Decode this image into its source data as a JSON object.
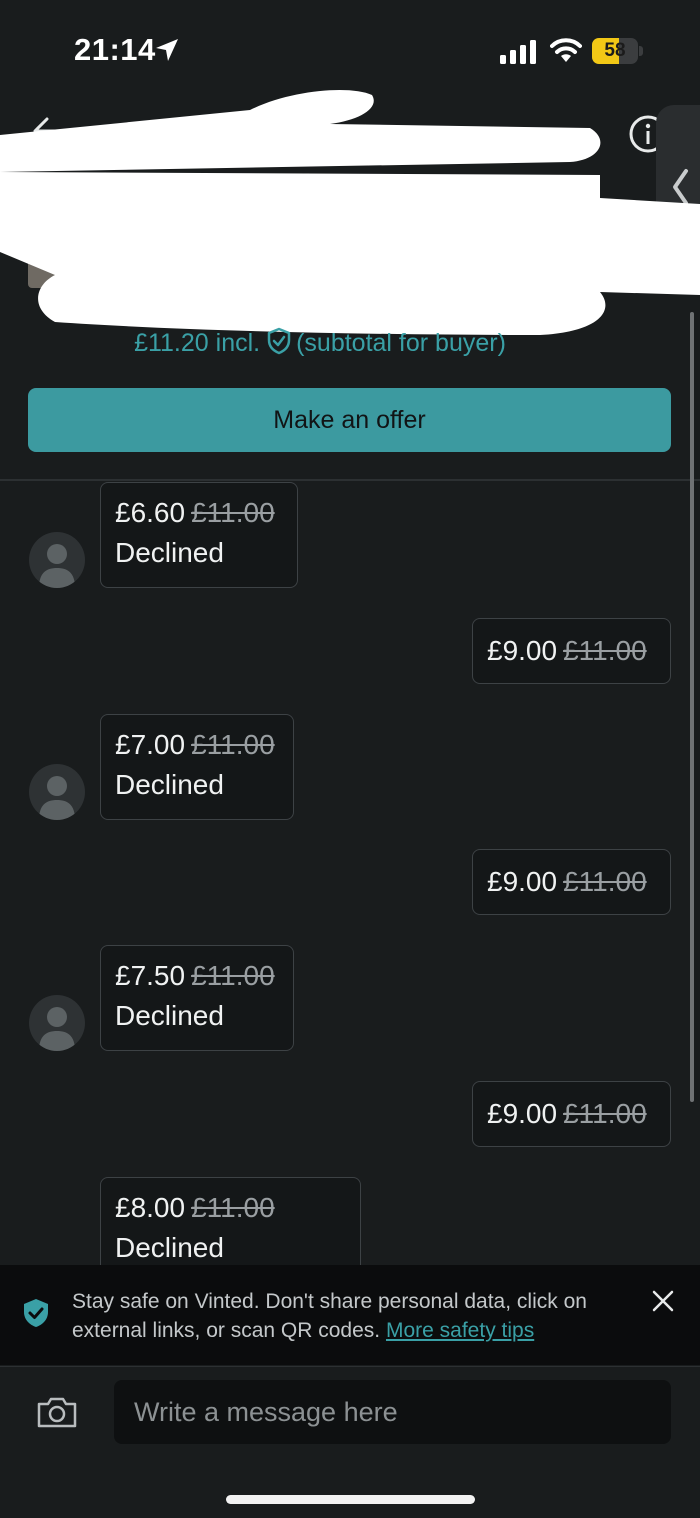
{
  "status_bar": {
    "time": "21:14",
    "battery_percent": "58",
    "battery_level": 0.58,
    "icons": [
      "location-arrow-icon",
      "signal-icon",
      "wifi-icon",
      "battery-icon"
    ]
  },
  "header": {
    "back_icon": "arrow-left-icon",
    "info_icon": "info-icon",
    "side_panel_icon": "chevron-left-icon"
  },
  "listing": {
    "price_incl": "£11.20 incl.",
    "price_note": "(subtotal for buyer)",
    "buyer_protection_icon": "shield-check-icon"
  },
  "offer_button": {
    "label": "Make an offer"
  },
  "messages": [
    {
      "direction": "incoming",
      "price": "£6.60",
      "original": "£11.00",
      "status": "Declined"
    },
    {
      "direction": "outgoing",
      "price": "£9.00",
      "original": "£11.00"
    },
    {
      "direction": "incoming",
      "price": "£7.00",
      "original": "£11.00",
      "status": "Declined"
    },
    {
      "direction": "outgoing",
      "price": "£9.00",
      "original": "£11.00"
    },
    {
      "direction": "incoming",
      "price": "£7.50",
      "original": "£11.00",
      "status": "Declined"
    },
    {
      "direction": "outgoing",
      "price": "£9.00",
      "original": "£11.00"
    },
    {
      "direction": "incoming",
      "price": "£8.00",
      "original": "£11.00",
      "status": "Declined"
    }
  ],
  "safety_banner": {
    "text": "Stay safe on Vinted. Don't share personal data, click on external links, or scan QR codes.",
    "link": "More safety tips",
    "icons": [
      "shield-check-icon",
      "close-icon"
    ]
  },
  "composer": {
    "placeholder": "Write a message here",
    "camera_icon": "camera-icon"
  },
  "colors": {
    "background": "#191c1d",
    "accent": "#3c9aa0",
    "link": "#3aa0a6",
    "battery": "#f2c816"
  }
}
